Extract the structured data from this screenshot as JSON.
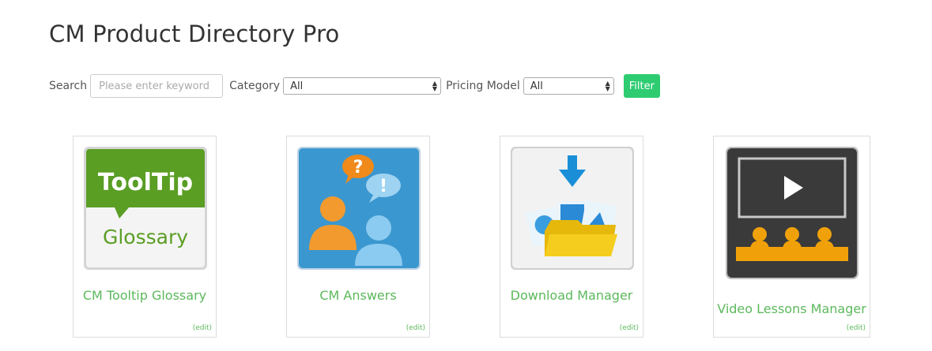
{
  "page": {
    "title": "CM Product Directory Pro"
  },
  "filters": {
    "search_label": "Search",
    "search_placeholder": "Please enter keyword",
    "category_label": "Category",
    "category_value": "All",
    "pricing_label": "Pricing Model",
    "pricing_value": "All",
    "filter_button": "Filter"
  },
  "products": [
    {
      "name": "CM Tooltip Glossary",
      "edit": "(edit)",
      "logo_top": "ToolTip",
      "logo_bottom": "Glossary",
      "icon": "tooltip-glossary-logo"
    },
    {
      "name": "CM Answers",
      "edit": "(edit)",
      "logo_q": "?",
      "logo_excl": "!",
      "icon": "answers-logo"
    },
    {
      "name": "Download Manager",
      "edit": "(edit)",
      "icon": "download-manager-logo"
    },
    {
      "name": "Video Lessons Manager",
      "edit": "(edit)",
      "icon": "video-lessons-logo"
    }
  ],
  "colors": {
    "accent": "#2ecc71",
    "link": "#5cb85c"
  }
}
